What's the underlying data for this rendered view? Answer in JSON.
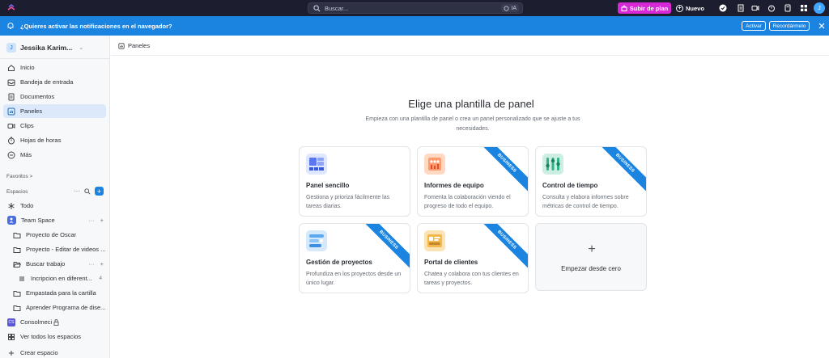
{
  "topbar": {
    "search_placeholder": "Buscar...",
    "ai_label": "IA",
    "upgrade_label": "Subir de plan",
    "new_label": "Nuevo",
    "avatar_initial": "J"
  },
  "notification": {
    "text": "¿Quieres activar las notificaciones en el navegador?",
    "activate_label": "Activar",
    "remind_label": "Recordármelo"
  },
  "sidebar": {
    "workspace_initial": "J",
    "workspace_name": "Jessika Karim...",
    "nav": [
      {
        "label": "Inicio",
        "icon": "home-icon"
      },
      {
        "label": "Bandeja de entrada",
        "icon": "inbox-icon"
      },
      {
        "label": "Documentos",
        "icon": "document-icon"
      },
      {
        "label": "Paneles",
        "icon": "dashboard-icon",
        "active": true
      },
      {
        "label": "Clips",
        "icon": "video-icon"
      },
      {
        "label": "Hojas de horas",
        "icon": "timesheet-icon"
      },
      {
        "label": "Más",
        "icon": "more-icon"
      }
    ],
    "favorites_label": "Favoritos",
    "favorites_chevron": ">",
    "spaces_label": "Espacios",
    "spaces_more": "···",
    "tree": [
      {
        "label": "Todo"
      },
      {
        "label": "Team Space",
        "more": "···",
        "add": "+"
      },
      {
        "label": "Proyecto de Oscar"
      },
      {
        "label": "Proyecto - Editar de videos ..."
      },
      {
        "label": "Buscar trabajo",
        "more": "···",
        "add": "+"
      },
      {
        "label": "Incripcion en diferent...",
        "count": "4"
      },
      {
        "label": "Empastada para la cartilla"
      },
      {
        "label": "Aprender Programa de dise..."
      },
      {
        "label": "Consolmeci"
      },
      {
        "label": "Ver todos los espacios"
      },
      {
        "label": "Crear espacio"
      }
    ]
  },
  "main": {
    "breadcrumb": "Paneles",
    "heading": "Elige una plantilla de panel",
    "subtext": "Empieza con una plantilla de panel o crea un panel personalizado que se ajuste a tus necesidades.",
    "badge_text": "BUSINESS",
    "cards": [
      {
        "title": "Panel sencillo",
        "desc": "Gestiona y prioriza fácilmente las tareas diarias.",
        "business": false,
        "color": "#dfe7ff"
      },
      {
        "title": "Informes de equipo",
        "desc": "Fomenta la colaboración viendo el progreso de todo el equipo.",
        "business": true,
        "color": "#ffd9c2"
      },
      {
        "title": "Control de tiempo",
        "desc": "Consulta y elabora informes sobre métricas de control de tiempo.",
        "business": true,
        "color": "#cdeee2"
      },
      {
        "title": "Gestión de proyectos",
        "desc": "Profundiza en los proyectos desde un único lugar.",
        "business": true,
        "color": "#d6e9fb"
      },
      {
        "title": "Portal de clientes",
        "desc": "Chatea y colabora con tus clientes en tareas y proyectos.",
        "business": true,
        "color": "#fbe3b5"
      }
    ],
    "blank_label": "Empezar desde cero",
    "blank_plus": "+"
  }
}
